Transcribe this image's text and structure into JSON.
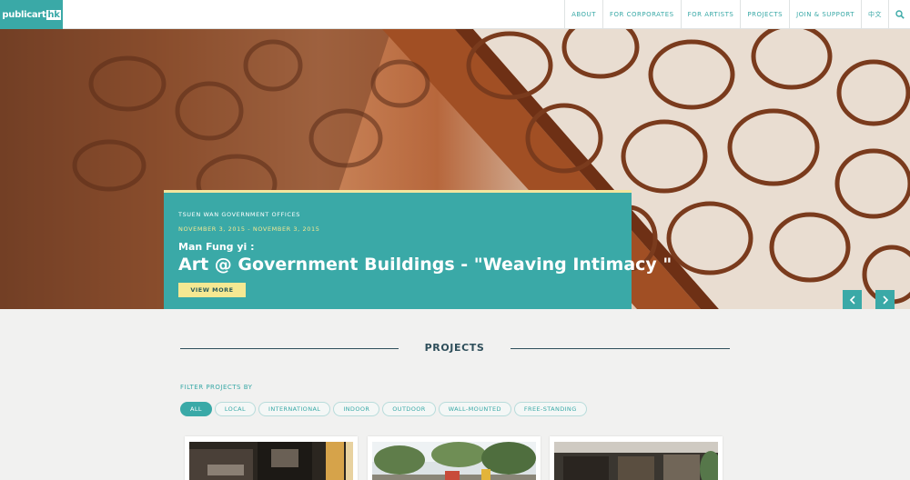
{
  "logo": {
    "part1": "public",
    "part2": "art",
    "part3": "hk"
  },
  "nav": {
    "items": [
      "ABOUT",
      "FOR CORPORATES",
      "FOR ARTISTS",
      "PROJECTS",
      "JOIN & SUPPORT",
      "中文"
    ],
    "search_icon": "search-icon"
  },
  "hero": {
    "venue": "TSUEN WAN GOVERNMENT OFFICES",
    "date": "NOVEMBER 3, 2015 - NOVEMBER 3, 2015",
    "artist": "Man Fung yi :",
    "title": "Art @ Government Buildings - \"Weaving Intimacy \"",
    "button": "VIEW MORE",
    "prev_icon": "chevron-left-icon",
    "next_icon": "chevron-right-icon"
  },
  "projects": {
    "title": "PROJECTS",
    "filter_label": "FILTER PROJECTS BY",
    "filters": [
      "ALL",
      "LOCAL",
      "INTERNATIONAL",
      "INDOOR",
      "OUTDOOR",
      "WALL-MOUNTED",
      "FREE-STANDING"
    ],
    "active_filter": "ALL"
  },
  "colors": {
    "accent": "#3aa9a7",
    "highlight": "#f5e892",
    "heading": "#2e4e5a"
  }
}
